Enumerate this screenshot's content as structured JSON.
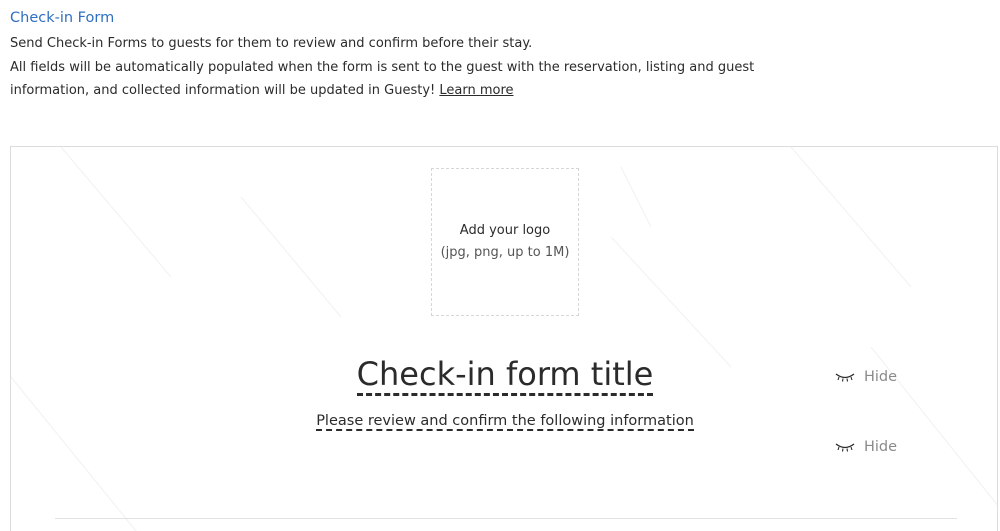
{
  "intro": {
    "title": "Check-in Form",
    "line1": "Send Check-in Forms to guests for them to review and confirm before their stay.",
    "line2": "All fields will be automatically populated when the form is sent to the guest with the reservation, listing and guest information, and collected information will be updated in Guesty! ",
    "learn_more": "Learn more"
  },
  "form_preview": {
    "logo": {
      "label": "Add your logo",
      "hint": "(jpg, png, up to 1M)"
    },
    "title": "Check-in form title",
    "subtitle": "Please review and confirm the following information",
    "hide_title_label": "Hide",
    "hide_subtitle_label": "Hide",
    "hide_icon": "eye-closed-icon"
  },
  "colors": {
    "link": "#2f6fc0",
    "text": "#2b2b2b",
    "muted": "#8a8a8a",
    "border": "#dcdcdc"
  }
}
